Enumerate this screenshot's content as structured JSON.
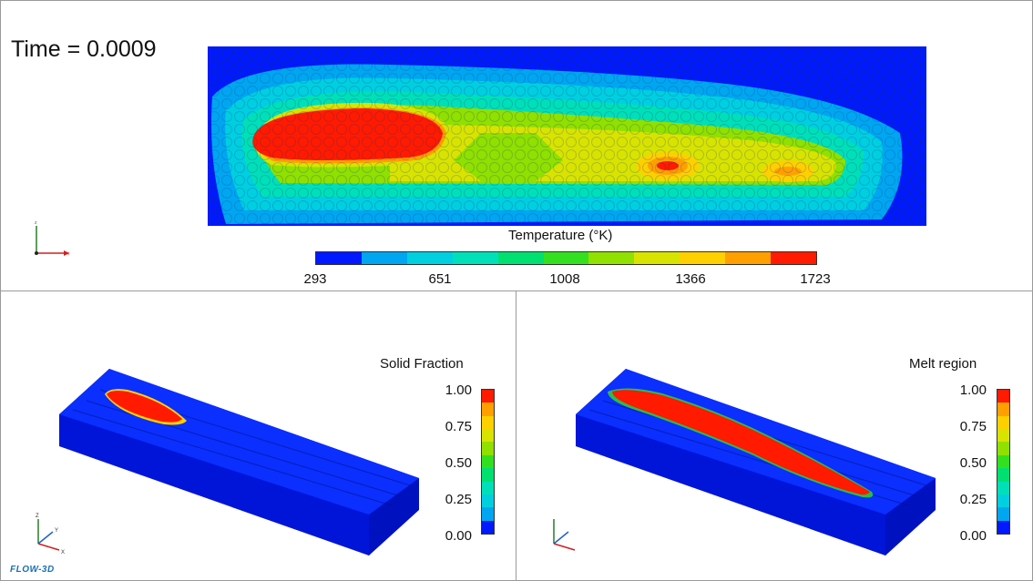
{
  "time_label": "Time = 0.0009",
  "temperature": {
    "title": "Temperature (°K)",
    "ticks": [
      "293",
      "651",
      "1008",
      "1366",
      "1723"
    ],
    "colors": [
      "#0019ff",
      "#00a6f0",
      "#00cfe0",
      "#00e0b8",
      "#00e070",
      "#33e020",
      "#90e000",
      "#d8e400",
      "#ffd000",
      "#ffa000",
      "#ff1a00"
    ]
  },
  "solid_fraction": {
    "title": "Solid Fraction",
    "ticks": [
      "1.00",
      "0.75",
      "0.50",
      "0.25",
      "0.00"
    ],
    "colors": [
      "#0019ff",
      "#00a6f0",
      "#00cfe0",
      "#00e0b8",
      "#00e070",
      "#33e020",
      "#90e000",
      "#d8e400",
      "#ffd000",
      "#ffa000",
      "#ff1a00"
    ]
  },
  "melt_region": {
    "title": "Melt region",
    "ticks": [
      "1.00",
      "0.75",
      "0.50",
      "0.25",
      "0.00"
    ],
    "colors": [
      "#ff1a00",
      "#ffa000",
      "#ffd000",
      "#d8e400",
      "#90e000",
      "#33e020",
      "#00e070",
      "#00e0b8",
      "#00cfe0",
      "#00a6f0",
      "#0019ff"
    ]
  },
  "axes": {
    "top": {
      "x": "x",
      "z": "z"
    },
    "bottom": {
      "x": "X",
      "y": "Y",
      "z": "Z"
    }
  },
  "logo": "FLOW-3D"
}
